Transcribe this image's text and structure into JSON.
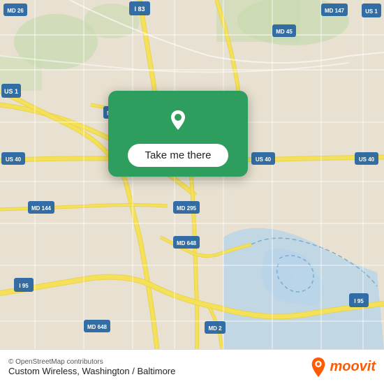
{
  "map": {
    "attribution": "© OpenStreetMap contributors",
    "location_title": "Custom Wireless, Washington / Baltimore",
    "background_color": "#e8e0d0"
  },
  "popup": {
    "button_label": "Take me there",
    "pin_icon": "location-pin"
  },
  "moovit": {
    "logo_text": "moovit",
    "pin_color": "#ff5a00"
  }
}
